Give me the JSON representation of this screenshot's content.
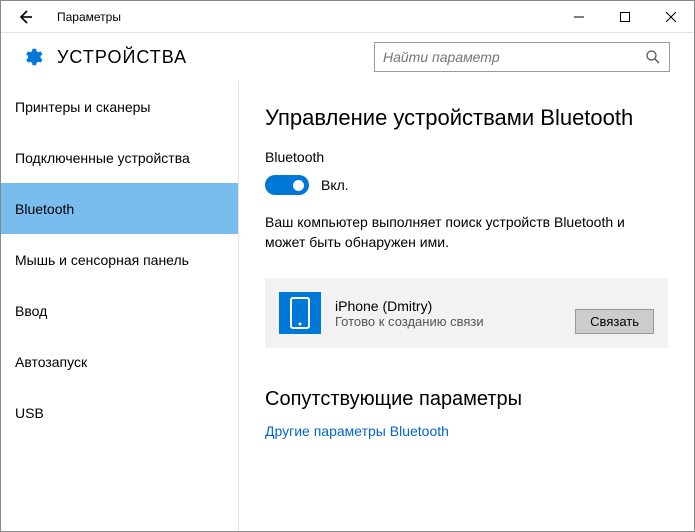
{
  "window": {
    "title": "Параметры"
  },
  "header": {
    "title": "УСТРОЙСТВА",
    "search_placeholder": "Найти параметр"
  },
  "sidebar": {
    "items": [
      {
        "label": "Принтеры и сканеры"
      },
      {
        "label": "Подключенные устройства"
      },
      {
        "label": "Bluetooth"
      },
      {
        "label": "Мышь и сенсорная панель"
      },
      {
        "label": "Ввод"
      },
      {
        "label": "Автозапуск"
      },
      {
        "label": "USB"
      }
    ],
    "active_index": 2
  },
  "main": {
    "heading": "Управление устройствами Bluetooth",
    "bt_label": "Bluetooth",
    "toggle_on": true,
    "toggle_state_label": "Вкл.",
    "description": "Ваш компьютер выполняет поиск устройств Bluetooth и может быть обнаружен ими.",
    "device": {
      "name": "iPhone (Dmitry)",
      "status": "Готово к созданию связи",
      "connect_label": "Связать"
    },
    "related": {
      "heading": "Сопутствующие параметры",
      "link": "Другие параметры Bluetooth"
    }
  }
}
